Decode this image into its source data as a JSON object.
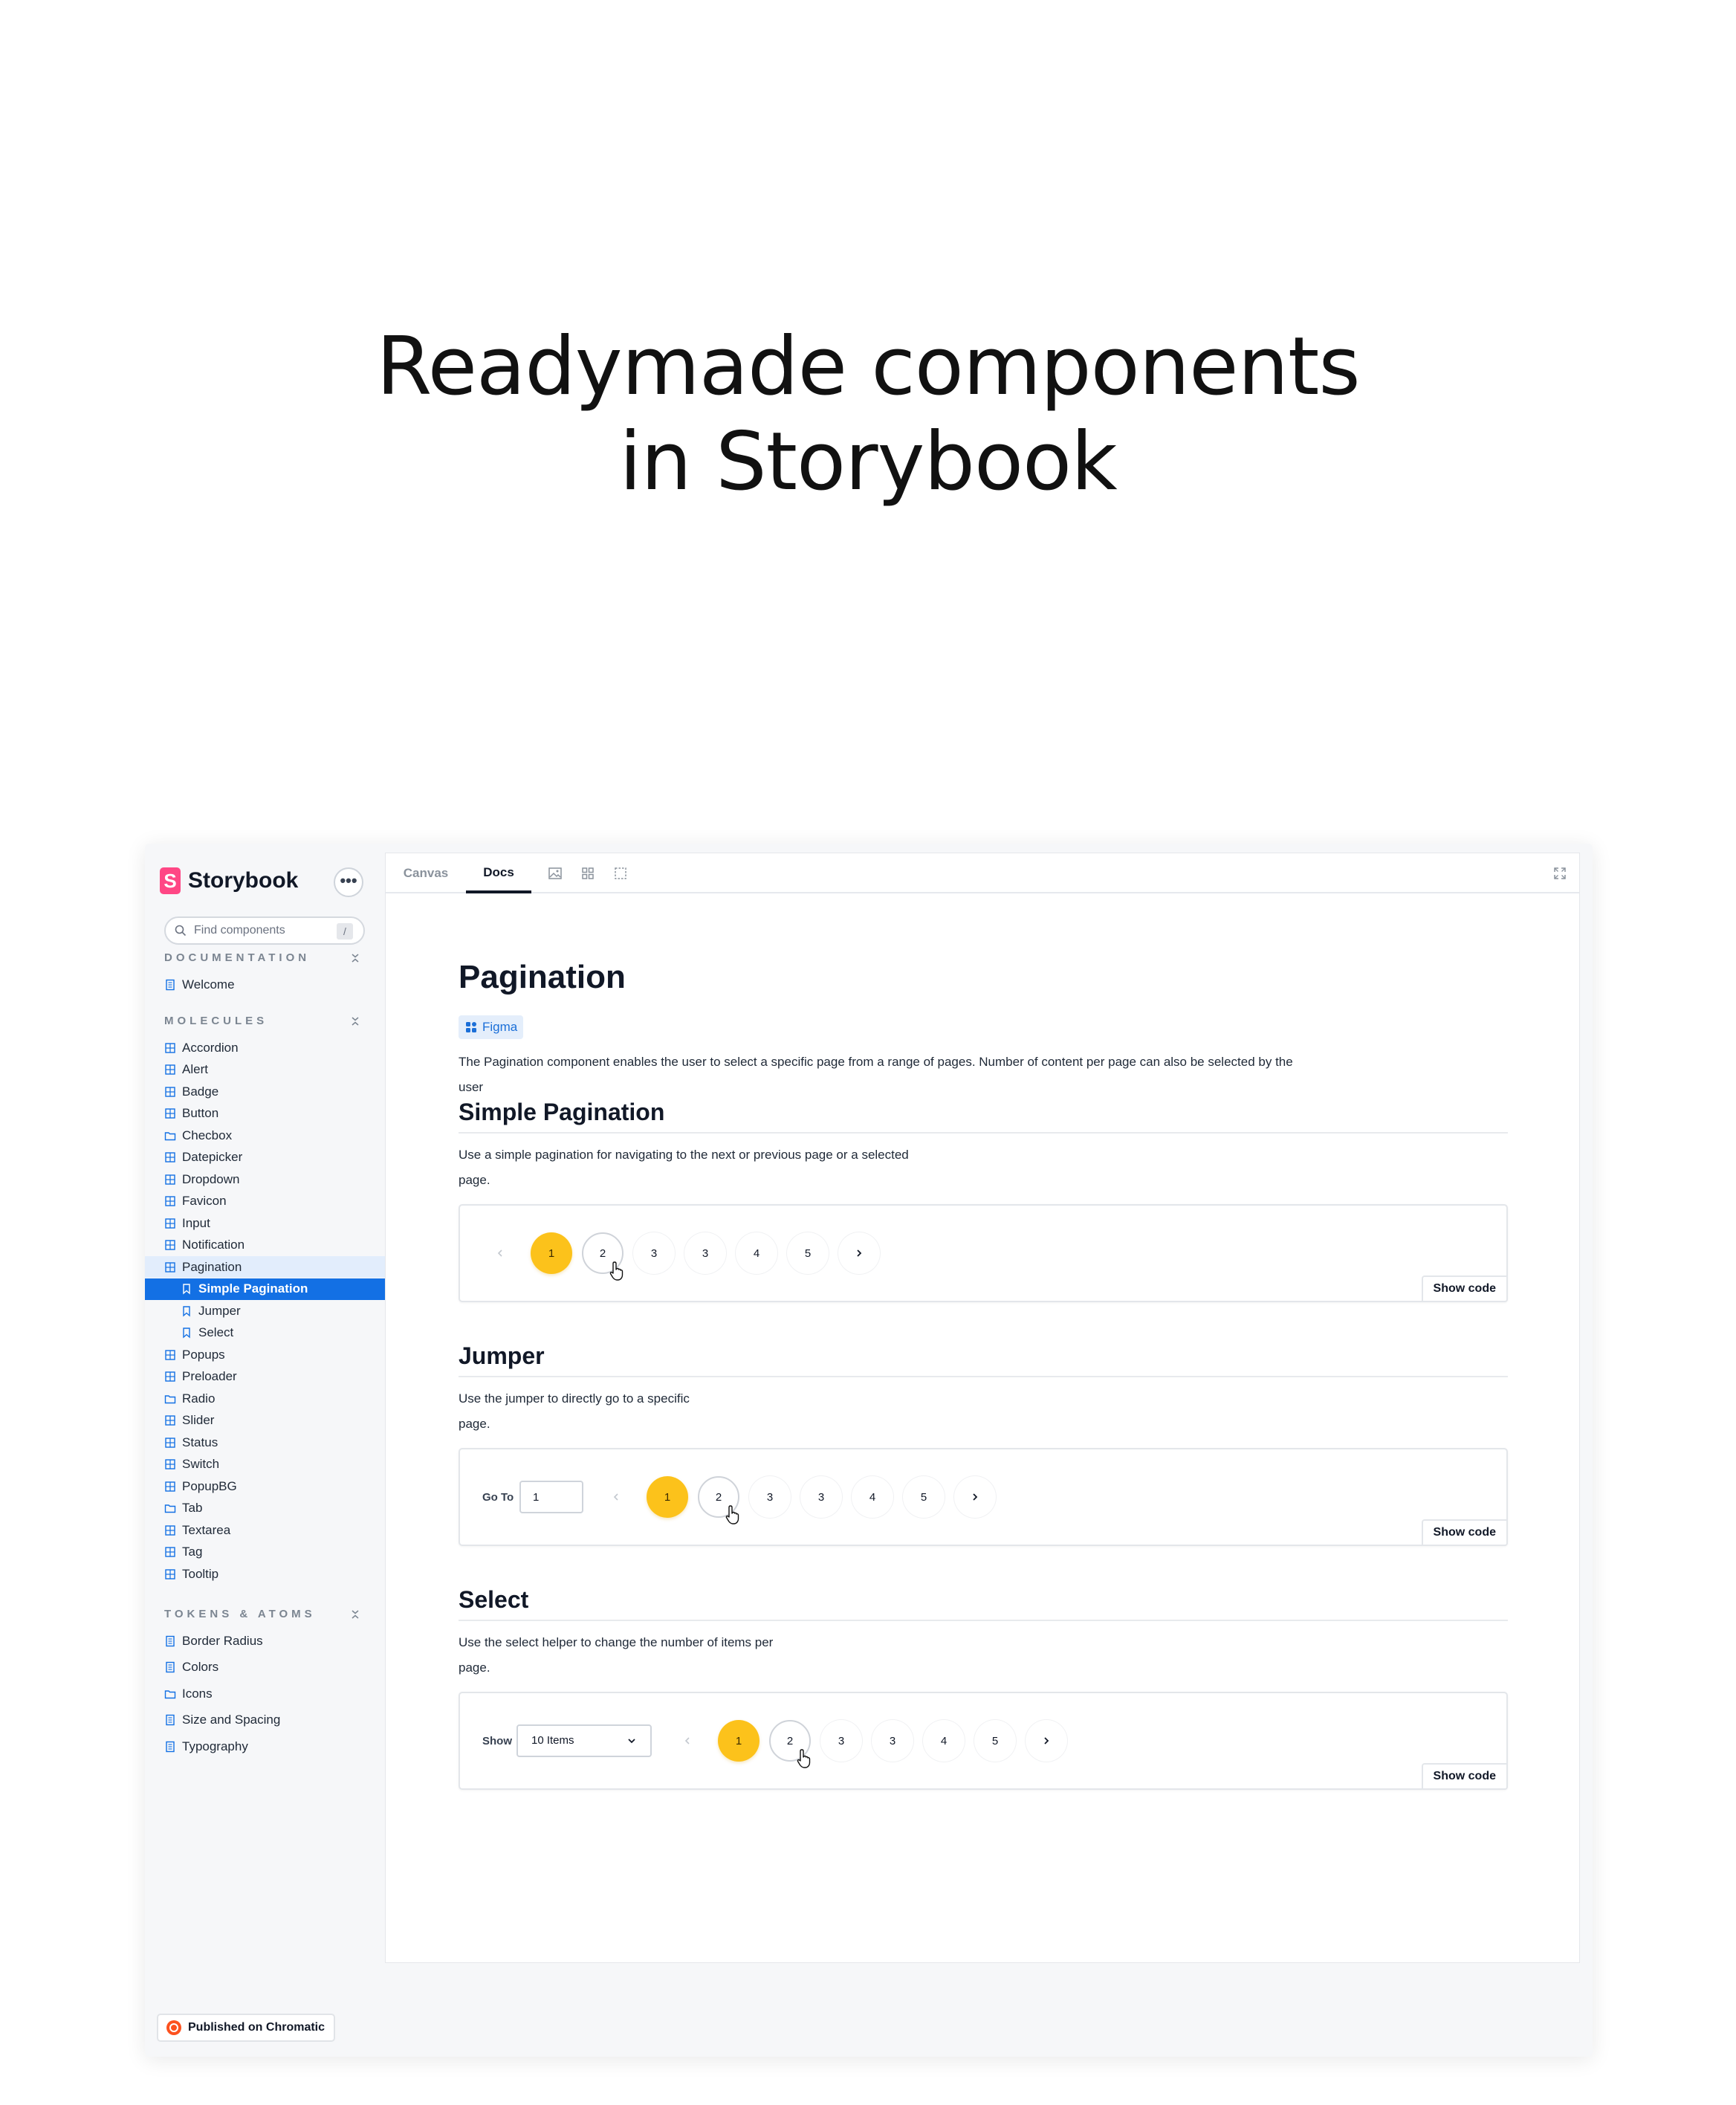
{
  "headline": {
    "line1": "Readymade components",
    "line2": "in Storybook"
  },
  "sidebar": {
    "brand": "Storybook",
    "brand_logo_letter": "S",
    "more_label": "•••",
    "search": {
      "placeholder": "Find components",
      "shortcut": "/"
    },
    "sections": [
      {
        "title": "DOCUMENTATION",
        "items": [
          {
            "label": "Welcome",
            "icon": "doc-icon"
          }
        ]
      },
      {
        "title": "MOLECULES",
        "items": [
          {
            "label": "Accordion",
            "icon": "component-icon"
          },
          {
            "label": "Alert",
            "icon": "component-icon"
          },
          {
            "label": "Badge",
            "icon": "component-icon"
          },
          {
            "label": "Button",
            "icon": "component-icon"
          },
          {
            "label": "Checbox",
            "icon": "folder-icon"
          },
          {
            "label": "Datepicker",
            "icon": "component-icon"
          },
          {
            "label": "Dropdown",
            "icon": "component-icon"
          },
          {
            "label": "Favicon",
            "icon": "component-icon"
          },
          {
            "label": "Input",
            "icon": "component-icon"
          },
          {
            "label": "Notification",
            "icon": "component-icon"
          },
          {
            "label": "Pagination",
            "icon": "component-icon",
            "state": "expanded"
          },
          {
            "label": "Simple Pagination",
            "icon": "bookmark-icon",
            "state": "active",
            "child": true
          },
          {
            "label": "Jumper",
            "icon": "bookmark-icon",
            "child": true
          },
          {
            "label": "Select",
            "icon": "bookmark-icon",
            "child": true
          },
          {
            "label": "Popups",
            "icon": "component-icon"
          },
          {
            "label": "Preloader",
            "icon": "component-icon"
          },
          {
            "label": "Radio",
            "icon": "folder-icon"
          },
          {
            "label": "Slider",
            "icon": "component-icon"
          },
          {
            "label": "Status",
            "icon": "component-icon"
          },
          {
            "label": "Switch",
            "icon": "component-icon"
          },
          {
            "label": "PopupBG",
            "icon": "component-icon"
          },
          {
            "label": "Tab",
            "icon": "folder-icon"
          },
          {
            "label": "Textarea",
            "icon": "component-icon"
          },
          {
            "label": "Tag",
            "icon": "component-icon"
          },
          {
            "label": "Tooltip",
            "icon": "component-icon"
          }
        ]
      },
      {
        "title": "TOKENS & ATOMS",
        "items": [
          {
            "label": "Border Radius",
            "icon": "doc-icon"
          },
          {
            "label": "Colors",
            "icon": "doc-icon"
          },
          {
            "label": "Icons",
            "icon": "folder-icon"
          },
          {
            "label": "Size and Spacing",
            "icon": "doc-icon"
          },
          {
            "label": "Typography",
            "icon": "doc-icon"
          }
        ]
      }
    ],
    "chromatic": "Published on Chromatic"
  },
  "toolbar": {
    "tabs": [
      "Canvas",
      "Docs"
    ],
    "active_tab": "Docs"
  },
  "doc": {
    "title": "Pagination",
    "figma_label": "Figma",
    "intro_line1": "The Pagination component enables the user to select a specific page from a range of pages. Number of content per page can also be selected by the",
    "intro_line2": "user",
    "sections": [
      {
        "heading": "Simple Pagination",
        "desc_line1": "Use a simple pagination for navigating to the next or previous page or a selected",
        "desc_line2": "page."
      },
      {
        "heading": "Jumper",
        "desc_line1": "Use the jumper to directly go to a specific",
        "desc_line2": "page.",
        "goto_label": "Go To",
        "goto_value": "1"
      },
      {
        "heading": "Select",
        "desc_line1": "Use the select helper to change the number of items per",
        "desc_line2": "page.",
        "show_label": "Show",
        "select_value": "10 Items"
      }
    ],
    "pages": [
      "1",
      "2",
      "3",
      "3",
      "4",
      "5"
    ],
    "current_page": "1",
    "show_code": "Show code"
  },
  "colors": {
    "accent": "#1370e4",
    "brand": "#ff4785",
    "page_current": "#fcc21b"
  }
}
